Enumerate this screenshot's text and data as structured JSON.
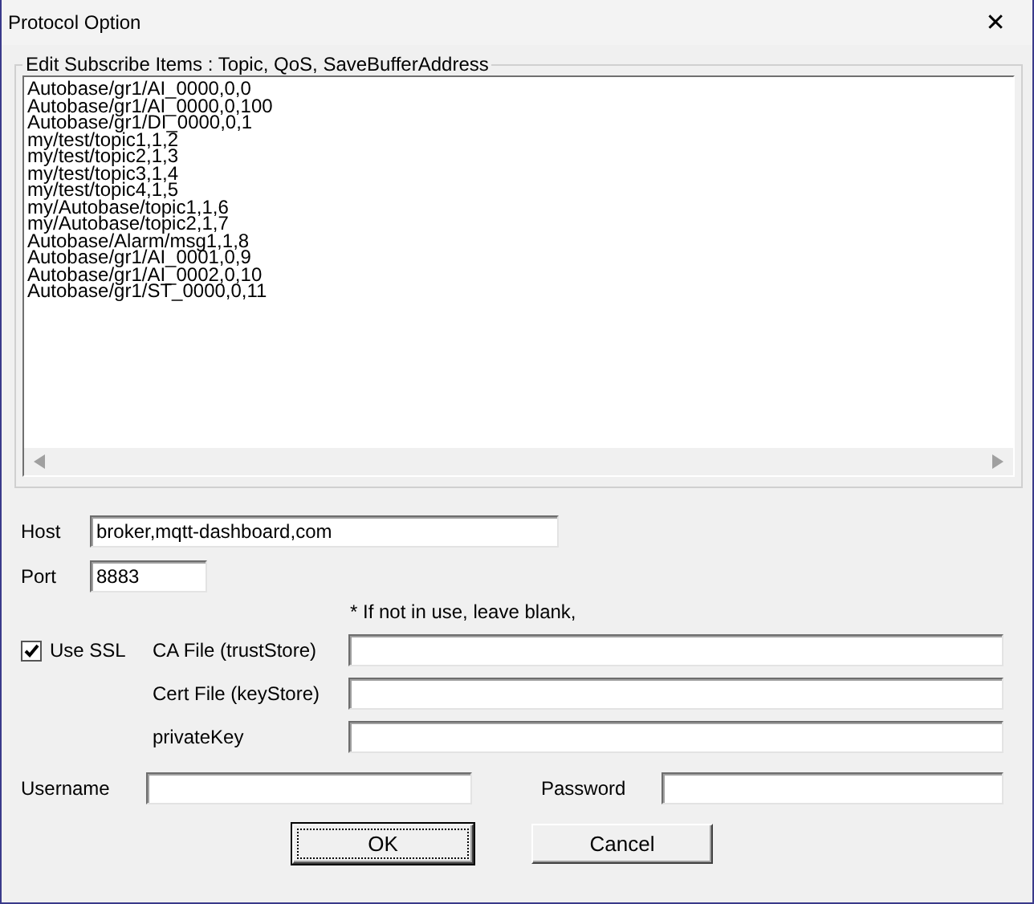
{
  "window": {
    "title": "Protocol Option",
    "close": "✕"
  },
  "group": {
    "legend": "Edit Subscribe Items : Topic, QoS, SaveBufferAddress",
    "items": [
      "Autobase/gr1/AI_0000,0,0",
      "Autobase/gr1/AI_0000,0,100",
      "Autobase/gr1/DI_0000,0,1",
      "my/test/topic1,1,2",
      "my/test/topic2,1,3",
      "my/test/topic3,1,4",
      "my/test/topic4,1,5",
      "my/Autobase/topic1,1,6",
      "my/Autobase/topic2,1,7",
      "Autobase/Alarm/msg1,1,8",
      "Autobase/gr1/AI_0001,0,9",
      "Autobase/gr1/AI_0002,0,10",
      "Autobase/gr1/ST_0000,0,11"
    ]
  },
  "host": {
    "label": "Host",
    "value": "broker,mqtt-dashboard,com"
  },
  "port": {
    "label": "Port",
    "value": "8883"
  },
  "note": "* If not in use, leave blank,",
  "ssl": {
    "label": "Use SSL",
    "checked": true,
    "fields": [
      {
        "label": "CA File (trustStore)"
      },
      {
        "label": "Cert File (keyStore)"
      },
      {
        "label": "privateKey"
      }
    ]
  },
  "username": {
    "label": "Username"
  },
  "password": {
    "label": "Password"
  },
  "buttons": [
    {
      "label": "OK",
      "focused": true
    },
    {
      "label": "Cancel",
      "focused": false
    }
  ]
}
